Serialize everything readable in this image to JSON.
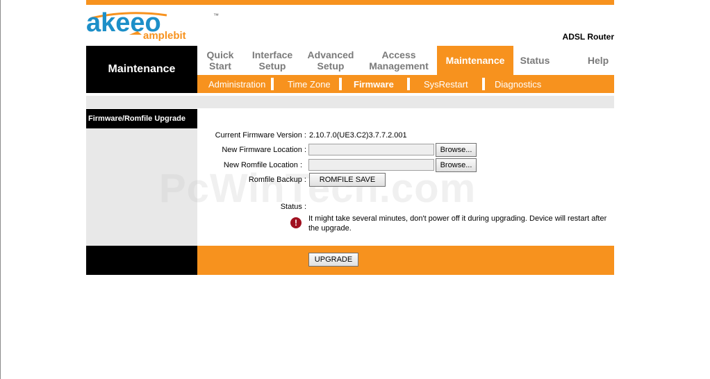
{
  "header": {
    "logo_text": "akeeo",
    "logo_sub": "amplebit",
    "logo_tm": "™",
    "product_name": "ADSL Router"
  },
  "sidebar": {
    "section_title": "Maintenance"
  },
  "nav": {
    "tabs": [
      {
        "line1": "Quick",
        "line2": "Start"
      },
      {
        "line1": "Interface",
        "line2": "Setup"
      },
      {
        "line1": "Advanced",
        "line2": "Setup"
      },
      {
        "line1": "Access",
        "line2": "Management"
      },
      {
        "line1": "Maintenance",
        "line2": ""
      },
      {
        "line1": "Status",
        "line2": ""
      },
      {
        "line1": "Help",
        "line2": ""
      }
    ],
    "active_tab": "Maintenance"
  },
  "subnav": {
    "items": [
      "Administration",
      "Time Zone",
      "Firmware",
      "SysRestart",
      "Diagnostics"
    ],
    "active": "Firmware"
  },
  "content": {
    "section_title": "Firmware/Romfile Upgrade",
    "current_fw_label": "Current Firmware Version :",
    "current_fw_value": "2.10.7.0(UE3.C2)3.7.7.2.001",
    "new_fw_label": "New Firmware Location :",
    "new_fw_value": "",
    "new_rom_label": "New Romfile Location :",
    "new_rom_value": "",
    "browse_label": "Browse...",
    "romfile_backup_label": "Romfile Backup :",
    "romfile_save_label": "ROMFILE SAVE",
    "status_label": "Status :",
    "warning_icon": "!",
    "warning_text": "It might take several minutes, don't power off it during upgrading. Device will restart after the upgrade."
  },
  "footer": {
    "upgrade_label": "UPGRADE"
  },
  "watermark": "PcWinTech.com",
  "colors": {
    "accent": "#f7921e",
    "black": "#000000",
    "grey": "#e8e8e8",
    "warning": "#a01020"
  }
}
